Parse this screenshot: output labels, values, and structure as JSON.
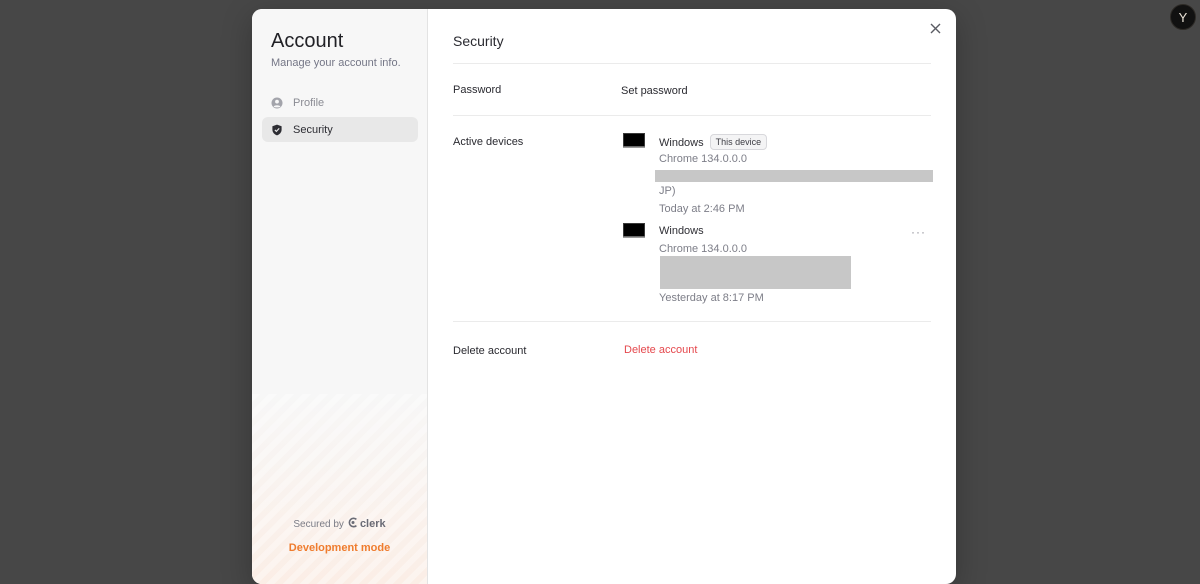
{
  "user": {
    "avatar_initial": "Y"
  },
  "sidebar": {
    "title": "Account",
    "subtitle": "Manage your account info.",
    "items": [
      {
        "label": "Profile",
        "icon": "user-circle-icon",
        "active": false
      },
      {
        "label": "Security",
        "icon": "shield-icon",
        "active": true
      }
    ],
    "secured_by": "Secured by",
    "brand": "clerk",
    "dev_mode": "Development mode"
  },
  "content": {
    "title": "Security",
    "password": {
      "label": "Password",
      "action": "Set password"
    },
    "active_devices": {
      "label": "Active devices",
      "devices": [
        {
          "os": "Windows",
          "badge": "This device",
          "browser": "Chrome 134.0.0.0",
          "location_fragment": "JP)",
          "last_active": "Today at 2:46 PM"
        },
        {
          "os": "Windows",
          "browser": "Chrome 134.0.0.0",
          "last_active": "Yesterday at 8:17 PM",
          "menu": "···"
        }
      ]
    },
    "delete_account": {
      "label": "Delete account",
      "action": "Delete account"
    },
    "close_symbol": "✕"
  },
  "colors": {
    "danger": "#e5484d",
    "accent_orange": "#ef7c2e",
    "backdrop": "#474747"
  }
}
